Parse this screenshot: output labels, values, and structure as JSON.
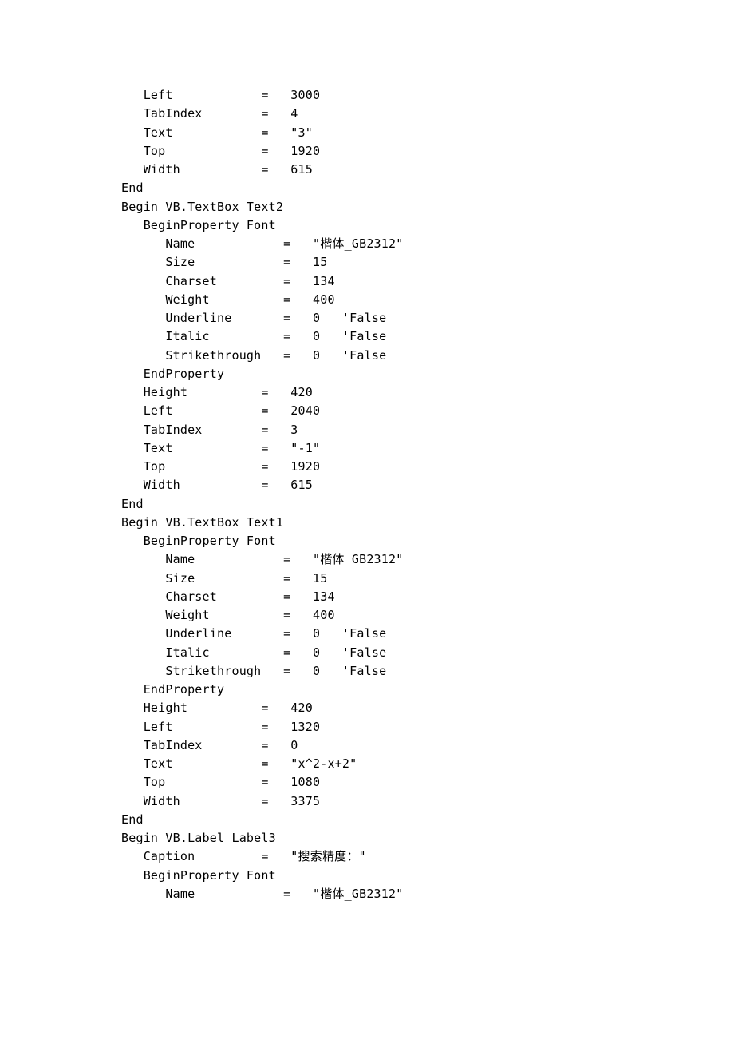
{
  "lines": [
    "   Left            =   3000",
    "   TabIndex        =   4",
    "   Text            =   \"3\"",
    "   Top             =   1920",
    "   Width           =   615",
    "End",
    "Begin VB.TextBox Text2 ",
    "   BeginProperty Font ",
    "      Name            =   \"楷体_GB2312\"",
    "      Size            =   15",
    "      Charset         =   134",
    "      Weight          =   400",
    "      Underline       =   0   'False",
    "      Italic          =   0   'False",
    "      Strikethrough   =   0   'False",
    "   EndProperty",
    "   Height          =   420",
    "   Left            =   2040",
    "   TabIndex        =   3",
    "   Text            =   \"-1\"",
    "   Top             =   1920",
    "   Width           =   615",
    "End",
    "Begin VB.TextBox Text1 ",
    "   BeginProperty Font ",
    "      Name            =   \"楷体_GB2312\"",
    "      Size            =   15",
    "      Charset         =   134",
    "      Weight          =   400",
    "      Underline       =   0   'False",
    "      Italic          =   0   'False",
    "      Strikethrough   =   0   'False",
    "   EndProperty",
    "   Height          =   420",
    "   Left            =   1320",
    "   TabIndex        =   0",
    "   Text            =   \"x^2-x+2\"",
    "   Top             =   1080",
    "   Width           =   3375",
    "End",
    "Begin VB.Label Label3 ",
    "   Caption         =   \"搜索精度：\"",
    "   BeginProperty Font ",
    "      Name            =   \"楷体_GB2312\""
  ]
}
